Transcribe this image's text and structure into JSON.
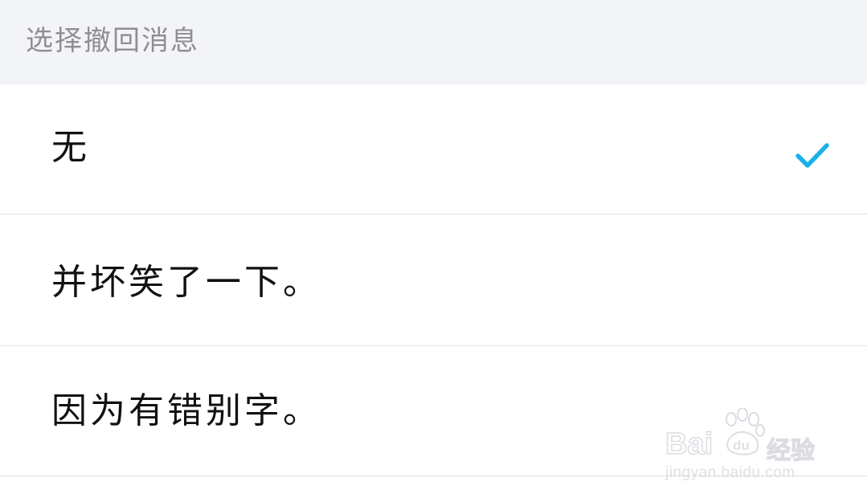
{
  "header": {
    "title": "选择撤回消息"
  },
  "options": [
    {
      "label": "无",
      "selected": true
    },
    {
      "label": "并坏笑了一下。",
      "selected": false
    },
    {
      "label": "因为有错别字。",
      "selected": false
    }
  ],
  "selected_icon": "checkmark-icon",
  "colors": {
    "header_bg": "#f3f4f8",
    "header_text": "#8e8e93",
    "check": "#1ab0e8",
    "divider": "#e2e2e6"
  },
  "watermark": {
    "brand": "Bai",
    "brand_suffix": "经验",
    "brand_paw_text": "du",
    "url": "jingyan.baidu.com"
  }
}
